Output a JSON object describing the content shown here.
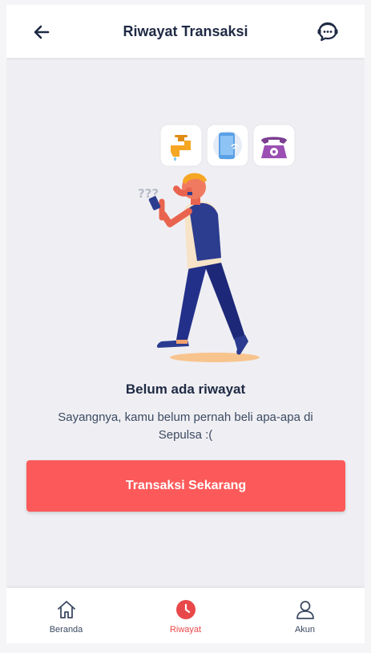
{
  "header": {
    "title": "Riwayat Transaksi",
    "back_icon": "arrow-left-icon",
    "help_icon": "chat-support-icon"
  },
  "illustration": {
    "icons": [
      "water-tap-icon",
      "mobile-phone-icon",
      "telephone-icon"
    ],
    "question_marks": "???"
  },
  "empty_state": {
    "title": "Belum ada riwayat",
    "description": "Sayangnya, kamu belum pernah beli apa-apa di Sepulsa :("
  },
  "cta": {
    "label": "Transaksi Sekarang"
  },
  "bottom_nav": {
    "items": [
      {
        "label": "Beranda",
        "icon": "home-icon",
        "active": false
      },
      {
        "label": "Riwayat",
        "icon": "clock-icon",
        "active": true
      },
      {
        "label": "Akun",
        "icon": "user-icon",
        "active": false
      }
    ]
  },
  "colors": {
    "primary_text": "#1f2a44",
    "accent": "#fc5a5a",
    "background": "#efeff3"
  }
}
